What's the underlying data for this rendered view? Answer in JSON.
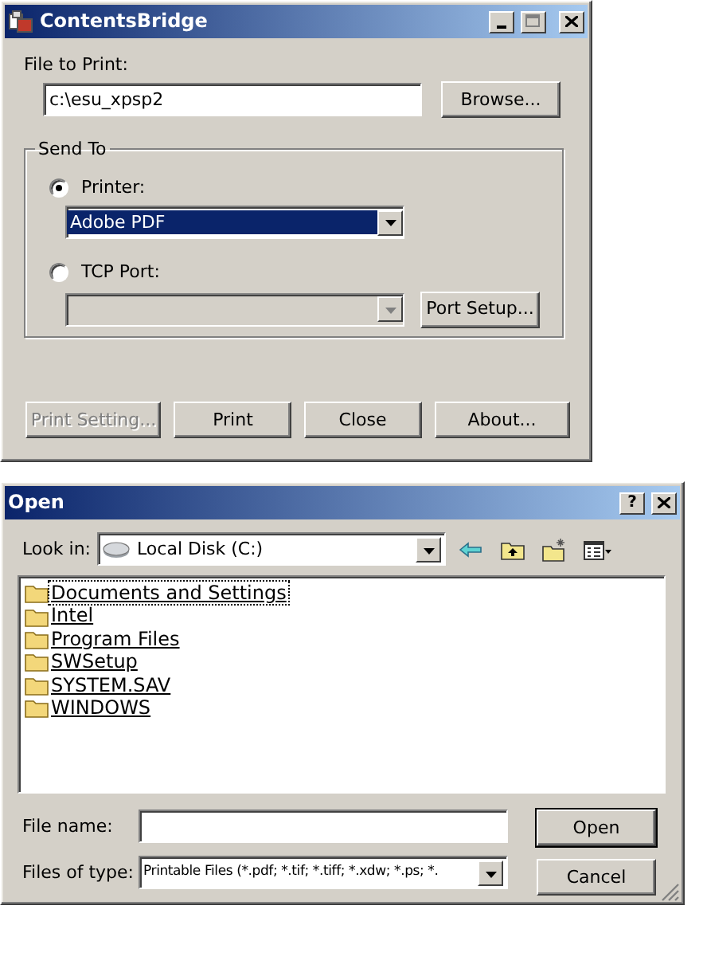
{
  "main_window": {
    "title": "ContentsBridge",
    "file_label": "File to Print:",
    "file_value": "c:\\esu_xpsp2",
    "browse_button": "Browse...",
    "group_title": "Send To",
    "destinations": [
      {
        "label": "Printer:",
        "selected": true,
        "value": "Adobe PDF",
        "disabled": false
      },
      {
        "label": "TCP Port:",
        "selected": false,
        "disabled": true
      }
    ],
    "port_setup_button": "Port Setup...",
    "buttons": [
      {
        "label": "Print Setting...",
        "disabled": true
      },
      {
        "label": "Print",
        "disabled": false
      },
      {
        "label": "Close",
        "disabled": false
      },
      {
        "label": "About...",
        "disabled": false
      }
    ]
  },
  "open_dialog": {
    "title": "Open",
    "help_button": "?",
    "look_in_label": "Look in:",
    "look_in_value": "Local Disk (C:)",
    "folders": [
      {
        "name": "Documents and Settings",
        "focused": true
      },
      {
        "name": "Intel",
        "focused": false
      },
      {
        "name": "Program Files",
        "focused": false
      },
      {
        "name": "SWSetup",
        "focused": false
      },
      {
        "name": "SYSTEM.SAV",
        "focused": false
      },
      {
        "name": "WINDOWS",
        "focused": false
      }
    ],
    "file_name_label": "File name:",
    "files_of_type_label": "Files of type:",
    "files_of_type_value": "Printable Files (*.pdf; *.tif; *.tiff; *.xdw; *.ps; *.",
    "open_button": "Open",
    "cancel_button": "Cancel"
  }
}
